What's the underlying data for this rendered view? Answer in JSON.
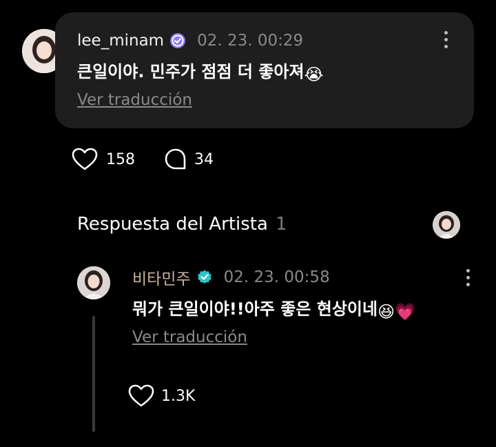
{
  "comment": {
    "username": "lee_minam",
    "date": "02. 23. 00:29",
    "text": "큰일이야. 민주가 점점 더 좋아져",
    "emoji": "😭",
    "translate_label": "Ver traducción",
    "likes": "158",
    "replies": "34"
  },
  "artist_section": {
    "title": "Respuesta del Artista",
    "count": "1"
  },
  "reply": {
    "username": "비타민주",
    "date": "02. 23. 00:58",
    "text": "뭐가 큰일이야!!아주 좋은 현상이네",
    "emoji1": "😆",
    "emoji2": "💗",
    "translate_label": "Ver traducción",
    "likes": "1.3K"
  },
  "colors": {
    "verified_user": "#8b7cf6",
    "verified_artist": "#2ec4c8",
    "card_bg": "#1e1e1e",
    "muted": "#8a8a8a"
  }
}
